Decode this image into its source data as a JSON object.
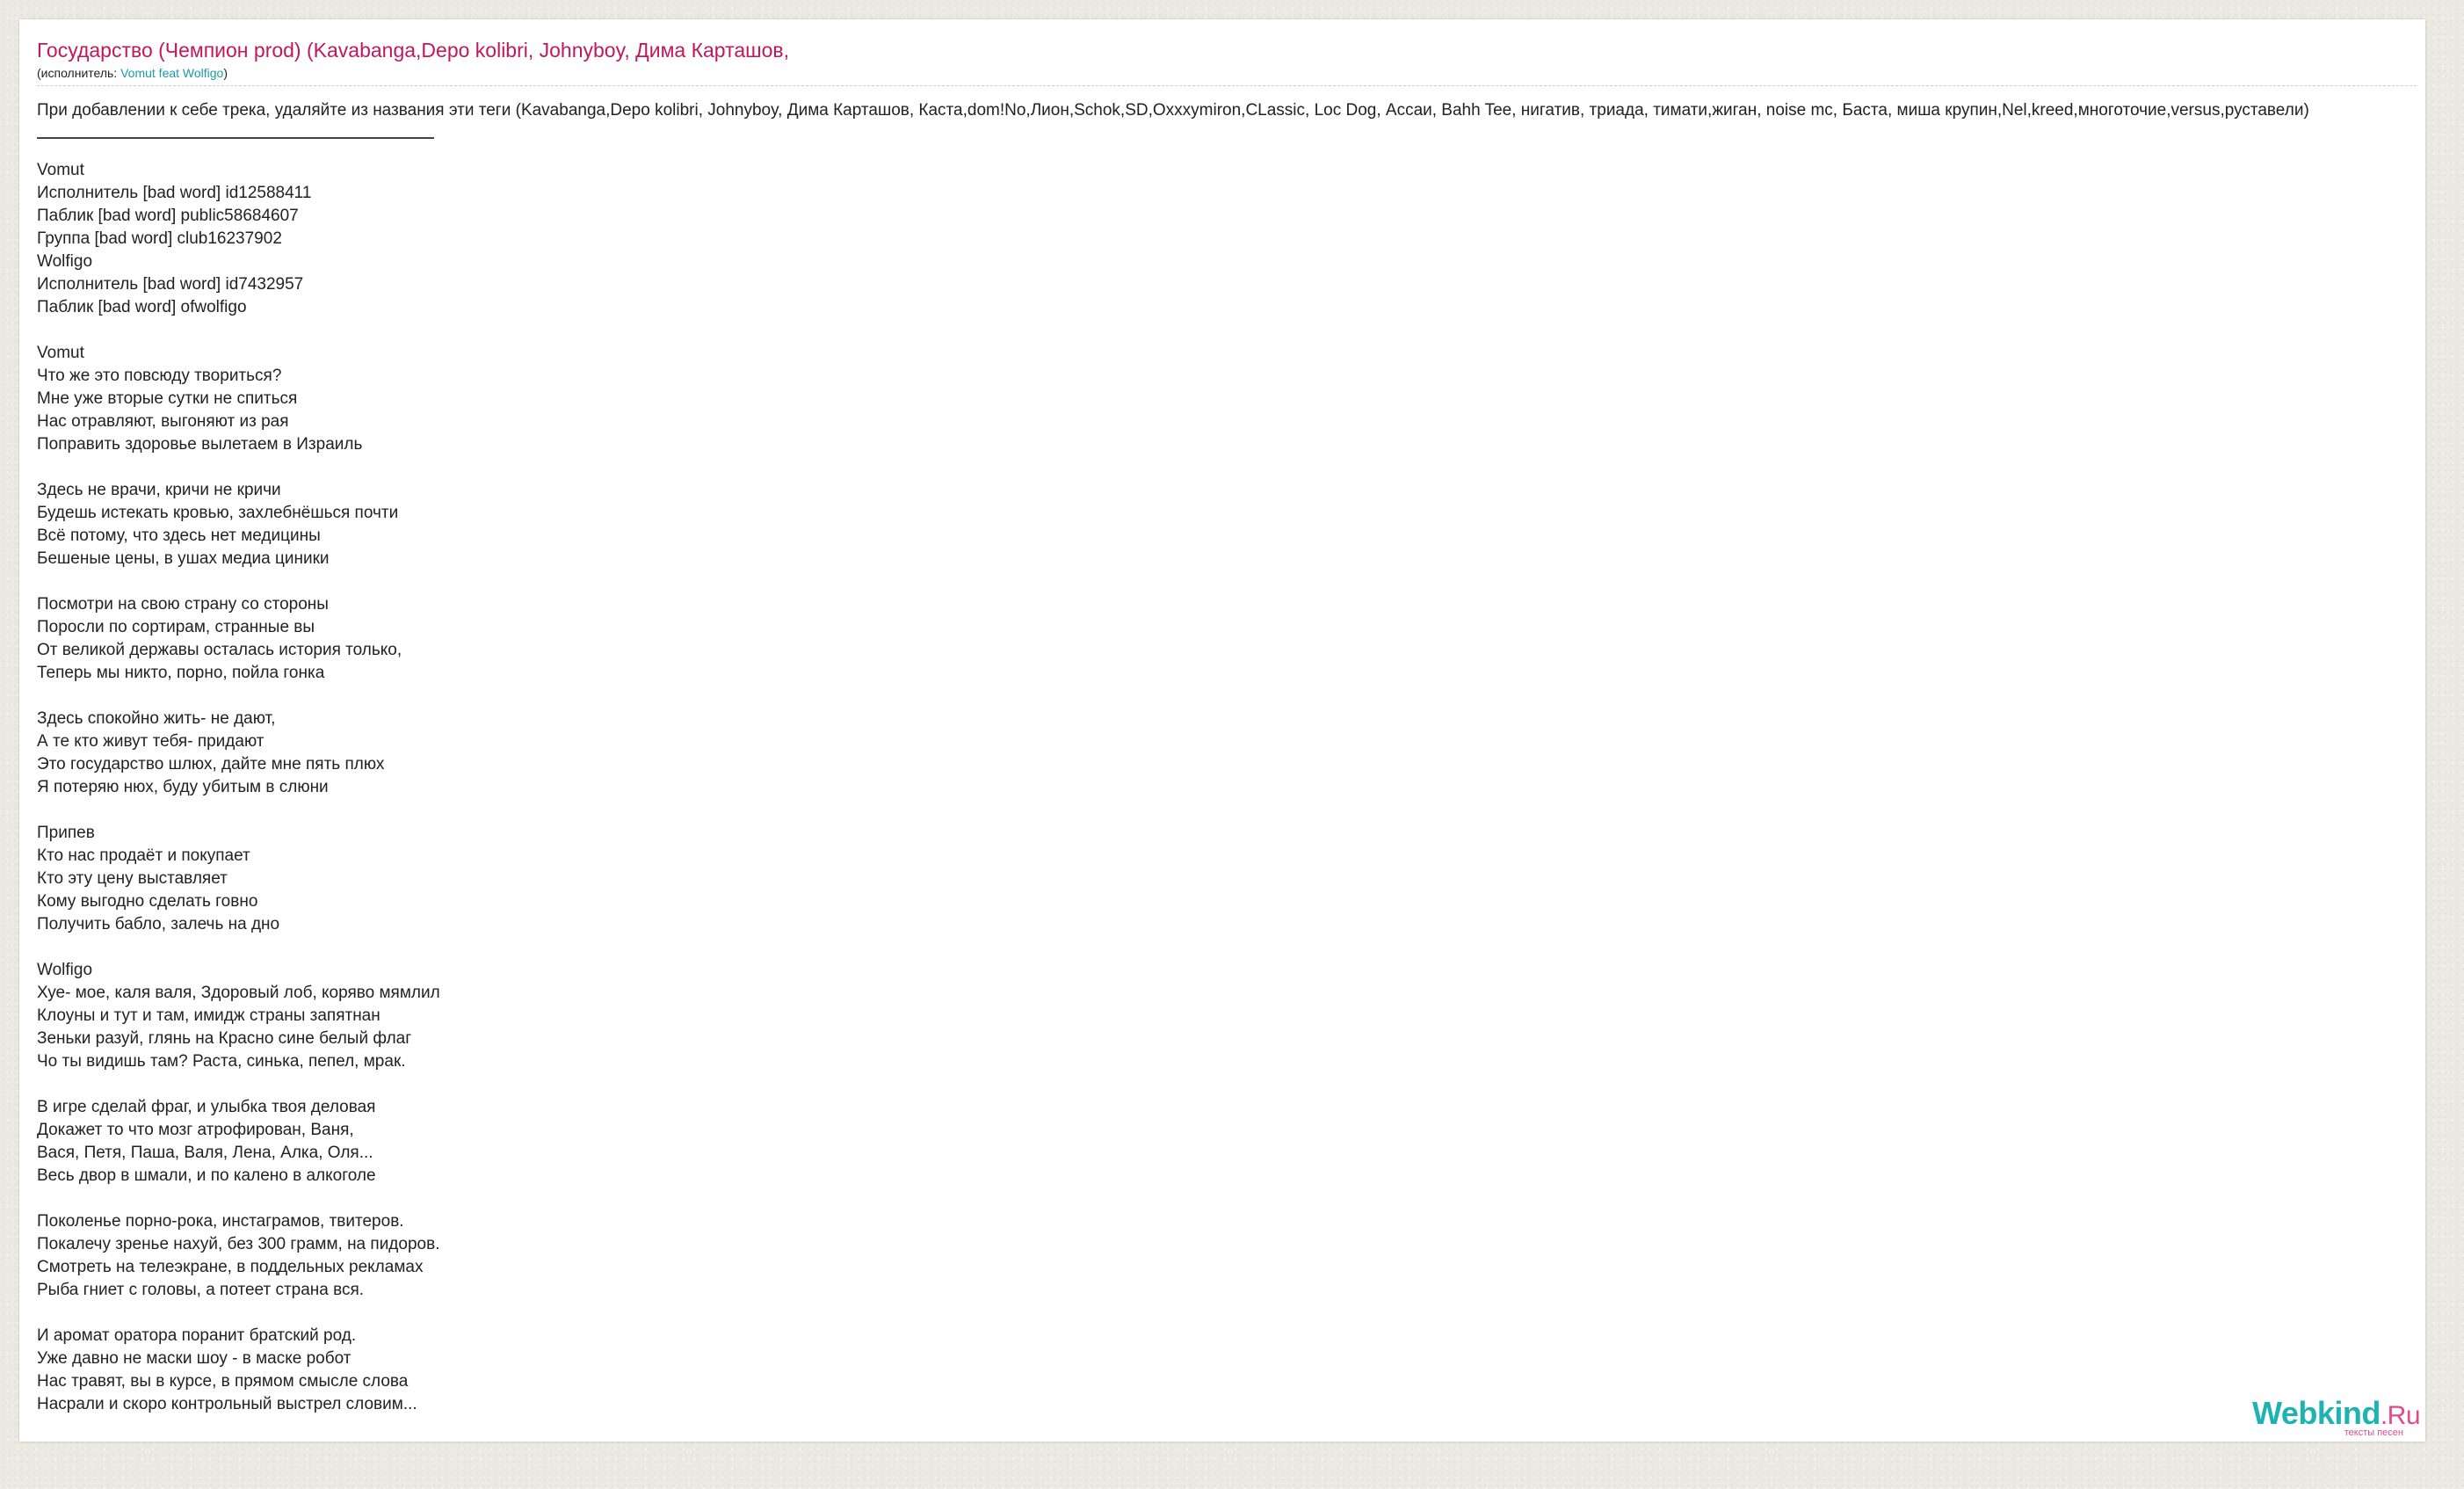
{
  "song": {
    "title": "Государство (Чемпион prod) (Kavabanga,Depo kolibri, Johnyboy, Дима Карташов,",
    "performer_label": "(исполнитель: ",
    "performer_name": "Vomut feat Wolfigo",
    "performer_close": ")"
  },
  "notice": "При добавлении к себе трека, удаляйте из названия эти теги (Kavabanga,Depo kolibri, Johnyboy, Дима Карташов, Каста,dom!No,Лион,Schok,SD,Oxxxymiron,CLassic, Loc Dog, Ассаи, Bahh Tee, нигатив, триада, тимати,жиган, noise mc, Баста, миша крупин,Nel,kreed,многоточие,versus,руставели)",
  "lyrics": [
    "Vomut",
    "Исполнитель [bad word] id12588411",
    "Паблик [bad word] public58684607",
    "Группа [bad word] club16237902",
    "Wolfigo",
    "Исполнитель [bad word] id7432957",
    "Паблик [bad word] ofwolfigo",
    "",
    "Vomut",
    "Что же это повсюду твориться?",
    "Мне уже вторые сутки не спиться",
    "Нас отравляют, выгоняют из рая",
    "Поправить здоровье вылетаем в Израиль",
    "",
    "Здесь не врачи, кричи не кричи",
    "Будешь истекать кровью, захлебнёшься почти",
    "Всё потому, что здесь нет медицины",
    "Бешеные цены, в ушах медиа циники",
    "",
    "Посмотри на свою страну со стороны",
    "Поросли по сортирам, странные вы",
    "От великой державы осталась история только,",
    "Теперь мы никто, порно, пойла гонка",
    "",
    "Здесь спокойно жить- не дают,",
    "А те кто живут тебя- придают",
    "Это государство шлюх, дайте мне пять плюх",
    "Я потеряю нюх, буду убитым в слюни",
    "",
    "Припев",
    "Кто нас продаёт и покупает",
    "Кто эту цену выставляет",
    "Кому выгодно сделать говно",
    "Получить бабло, залечь на дно",
    "",
    "Wolfigo",
    "Хуе- мое, каля валя, Здоровый лоб, коряво мямлил",
    "Клоуны и тут и там, имидж страны запятнан",
    "Зеньки разуй, глянь на Красно сине белый флаг",
    "Чо ты видишь там? Раста, синька, пепел, мрак.",
    "",
    "В игре сделай фраг, и улыбка твоя деловая",
    "Докажет то что мозг атрофирован, Ваня,",
    "Вася, Петя, Паша, Валя, Лена, Алка, Оля...",
    "Весь двор в шмали, и по калено в алкоголе",
    "",
    "Поколенье порно-рока, инстаграмов, твитеров.",
    "Покалечу зренье нахуй, без 300 грамм, на пидоров.",
    "Смотреть на телеэкране, в поддельных рекламах",
    "Рыба гниет с головы, а потеет страна вся.",
    "",
    "И аромат оратора поранит братский род.",
    "Уже давно не маски шоу - в маске робот",
    "Нас травят, вы в курсе, в прямом смысле слова",
    "Насрали и скоро контрольный выстрел словим..."
  ],
  "logo": {
    "main": "Webkind",
    "suffix": ".Ru",
    "tagline": "тексты песен"
  },
  "colors": {
    "title": "#c2185b",
    "link": "#1a9ba6",
    "logo_main": "#1fb2b2",
    "logo_accent": "#e24a8f",
    "background": "#ece8e2"
  }
}
